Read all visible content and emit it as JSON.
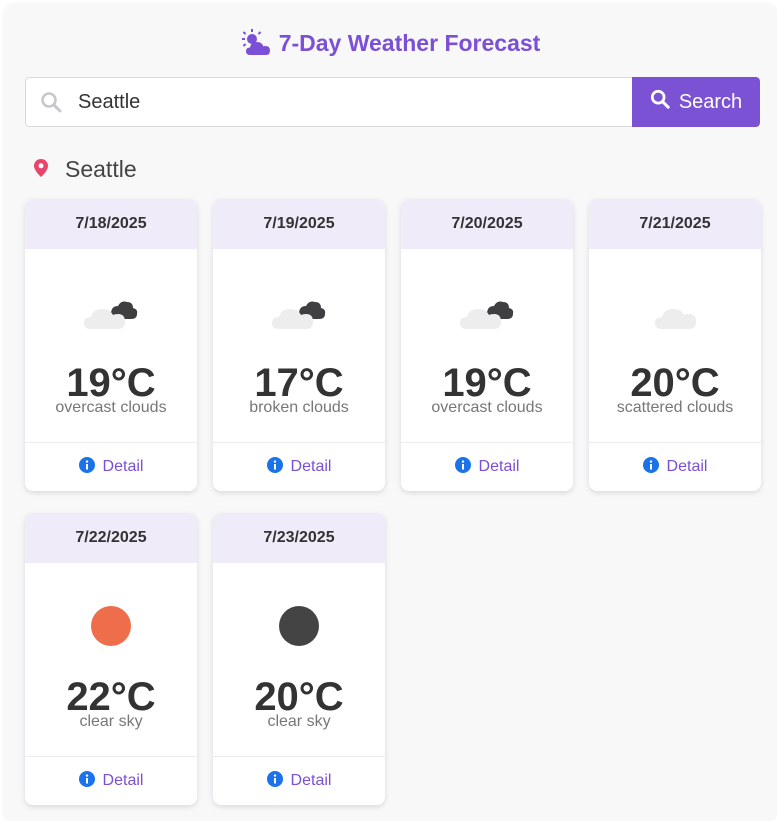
{
  "header": {
    "title": "7-Day Weather Forecast",
    "icon": "sun-behind-cloud-icon"
  },
  "search": {
    "value": "Seattle",
    "placeholder": "",
    "button_label": "Search"
  },
  "location": {
    "name": "Seattle",
    "icon": "map-pin-icon"
  },
  "colors": {
    "accent": "#7c52d5",
    "pin": "#e8456b",
    "info": "#1a73e8",
    "sun_day": "#ee6d4a",
    "sun_night": "#444444"
  },
  "forecast": [
    {
      "date": "7/18/2025",
      "temp": "19°C",
      "desc": "overcast clouds",
      "icon": "cloud-dark-icon",
      "detail": "Detail"
    },
    {
      "date": "7/19/2025",
      "temp": "17°C",
      "desc": "broken clouds",
      "icon": "cloud-dark-icon",
      "detail": "Detail"
    },
    {
      "date": "7/20/2025",
      "temp": "19°C",
      "desc": "overcast clouds",
      "icon": "cloud-dark-icon",
      "detail": "Detail"
    },
    {
      "date": "7/21/2025",
      "temp": "20°C",
      "desc": "scattered clouds",
      "icon": "cloud-light-icon",
      "detail": "Detail"
    },
    {
      "date": "7/22/2025",
      "temp": "22°C",
      "desc": "clear sky",
      "icon": "sun-icon",
      "detail": "Detail"
    },
    {
      "date": "7/23/2025",
      "temp": "20°C",
      "desc": "clear sky",
      "icon": "moon-icon",
      "detail": "Detail"
    }
  ]
}
